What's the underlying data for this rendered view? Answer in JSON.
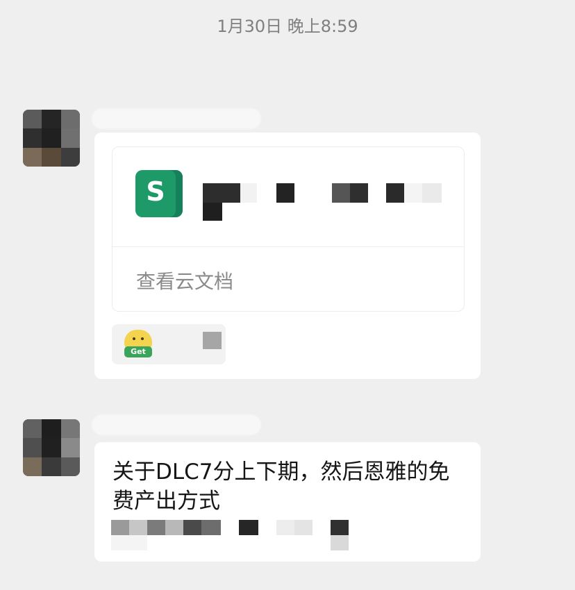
{
  "chat": {
    "timestamp": "1月30日 晚上8:59",
    "messages": [
      {
        "type": "cloud_doc",
        "doc_icon_letter": "S",
        "link_label": "查看云文档",
        "sticker_text": "Get"
      },
      {
        "type": "text",
        "text": "关于DLC7分上下期，然后恩雅的免费产出方式"
      }
    ]
  },
  "colors": {
    "background": "#efefef",
    "bubble": "#ffffff",
    "sheet_icon": "#1e9a68",
    "timestamp": "#7f7f7f"
  }
}
